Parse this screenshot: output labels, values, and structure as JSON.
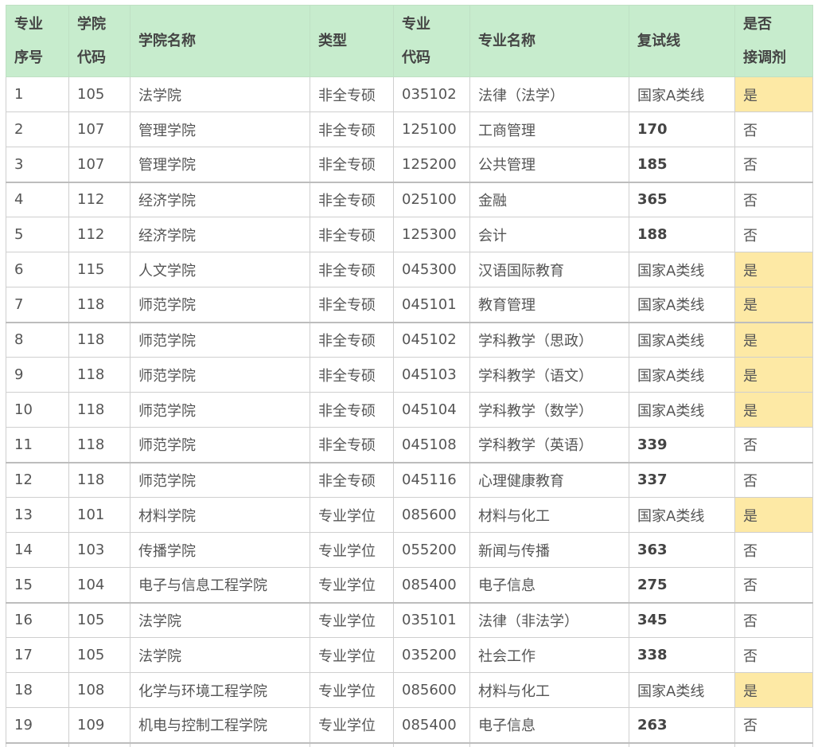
{
  "headers": {
    "seq": [
      "专业",
      "序号"
    ],
    "college_code": [
      "学院",
      "代码"
    ],
    "college_name": "学院名称",
    "type": "类型",
    "major_code": [
      "专业",
      "代码"
    ],
    "major_name": "专业名称",
    "retest_line": "复试线",
    "adjust": [
      "是否",
      "接调剂"
    ]
  },
  "colors": {
    "header_bg": "#c7eccd",
    "adjust_yes_bg": "#fde9a5"
  },
  "rows": [
    {
      "seq": "1",
      "college_code": "105",
      "college_name": "法学院",
      "type": "非全专硕",
      "major_code": "035102",
      "major_name": "法律（法学）",
      "retest_line": "国家A类线",
      "adjust": "是"
    },
    {
      "seq": "2",
      "college_code": "107",
      "college_name": "管理学院",
      "type": "非全专硕",
      "major_code": "125100",
      "major_name": "工商管理",
      "retest_line": "170",
      "adjust": "否"
    },
    {
      "seq": "3",
      "college_code": "107",
      "college_name": "管理学院",
      "type": "非全专硕",
      "major_code": "125200",
      "major_name": "公共管理",
      "retest_line": "185",
      "adjust": "否"
    },
    {
      "seq": "4",
      "college_code": "112",
      "college_name": "经济学院",
      "type": "非全专硕",
      "major_code": "025100",
      "major_name": "金融",
      "retest_line": "365",
      "adjust": "否"
    },
    {
      "seq": "5",
      "college_code": "112",
      "college_name": "经济学院",
      "type": "非全专硕",
      "major_code": "125300",
      "major_name": "会计",
      "retest_line": "188",
      "adjust": "否"
    },
    {
      "seq": "6",
      "college_code": "115",
      "college_name": "人文学院",
      "type": "非全专硕",
      "major_code": "045300",
      "major_name": "汉语国际教育",
      "retest_line": "国家A类线",
      "adjust": "是"
    },
    {
      "seq": "7",
      "college_code": "118",
      "college_name": "师范学院",
      "type": "非全专硕",
      "major_code": "045101",
      "major_name": "教育管理",
      "retest_line": "国家A类线",
      "adjust": "是"
    },
    {
      "seq": "8",
      "college_code": "118",
      "college_name": "师范学院",
      "type": "非全专硕",
      "major_code": "045102",
      "major_name": "学科教学（思政）",
      "retest_line": "国家A类线",
      "adjust": "是"
    },
    {
      "seq": "9",
      "college_code": "118",
      "college_name": "师范学院",
      "type": "非全专硕",
      "major_code": "045103",
      "major_name": "学科教学（语文）",
      "retest_line": "国家A类线",
      "adjust": "是"
    },
    {
      "seq": "10",
      "college_code": "118",
      "college_name": "师范学院",
      "type": "非全专硕",
      "major_code": "045104",
      "major_name": "学科教学（数学）",
      "retest_line": "国家A类线",
      "adjust": "是"
    },
    {
      "seq": "11",
      "college_code": "118",
      "college_name": "师范学院",
      "type": "非全专硕",
      "major_code": "045108",
      "major_name": "学科教学（英语）",
      "retest_line": "339",
      "adjust": "否"
    },
    {
      "seq": "12",
      "college_code": "118",
      "college_name": "师范学院",
      "type": "非全专硕",
      "major_code": "045116",
      "major_name": "心理健康教育",
      "retest_line": "337",
      "adjust": "否"
    },
    {
      "seq": "13",
      "college_code": "101",
      "college_name": "材料学院",
      "type": "专业学位",
      "major_code": "085600",
      "major_name": "材料与化工",
      "retest_line": "国家A类线",
      "adjust": "是"
    },
    {
      "seq": "14",
      "college_code": "103",
      "college_name": "传播学院",
      "type": "专业学位",
      "major_code": "055200",
      "major_name": "新闻与传播",
      "retest_line": "363",
      "adjust": "否"
    },
    {
      "seq": "15",
      "college_code": "104",
      "college_name": "电子与信息工程学院",
      "type": "专业学位",
      "major_code": "085400",
      "major_name": "电子信息",
      "retest_line": "275",
      "adjust": "否"
    },
    {
      "seq": "16",
      "college_code": "105",
      "college_name": "法学院",
      "type": "专业学位",
      "major_code": "035101",
      "major_name": "法律（非法学）",
      "retest_line": "345",
      "adjust": "否"
    },
    {
      "seq": "17",
      "college_code": "105",
      "college_name": "法学院",
      "type": "专业学位",
      "major_code": "035200",
      "major_name": "社会工作",
      "retest_line": "338",
      "adjust": "否"
    },
    {
      "seq": "18",
      "college_code": "108",
      "college_name": "化学与环境工程学院",
      "type": "专业学位",
      "major_code": "085600",
      "major_name": "材料与化工",
      "retest_line": "国家A类线",
      "adjust": "是"
    },
    {
      "seq": "19",
      "college_code": "109",
      "college_name": "机电与控制工程学院",
      "type": "专业学位",
      "major_code": "085400",
      "major_name": "电子信息",
      "retest_line": "263",
      "adjust": "否"
    },
    {
      "seq": "",
      "college_code": "",
      "college_name": "",
      "type": "",
      "major_code": "",
      "major_name": "",
      "retest_line": "",
      "adjust": ""
    }
  ]
}
